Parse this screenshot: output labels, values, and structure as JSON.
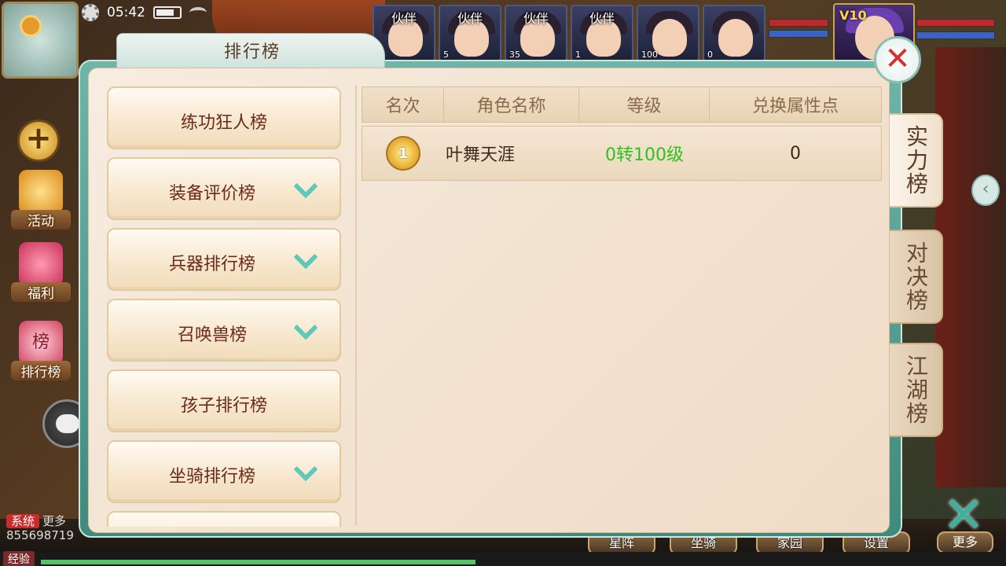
{
  "status_bar": {
    "time": "05:42"
  },
  "partners": [
    {
      "tag": "伙伴",
      "level": ""
    },
    {
      "tag": "伙伴",
      "level": "5"
    },
    {
      "tag": "伙伴",
      "level": "35"
    },
    {
      "tag": "伙伴",
      "level": "1"
    },
    {
      "tag": "",
      "level": "100"
    },
    {
      "tag": "",
      "level": "0"
    }
  ],
  "player": {
    "vip": "V10"
  },
  "panel": {
    "title": "排行榜",
    "close": "✕"
  },
  "categories": [
    {
      "label": "练功狂人榜",
      "expandable": false
    },
    {
      "label": "装备评价榜",
      "expandable": true
    },
    {
      "label": "兵器排行榜",
      "expandable": true
    },
    {
      "label": "召唤兽榜",
      "expandable": true
    },
    {
      "label": "孩子排行榜",
      "expandable": false
    },
    {
      "label": "坐骑排行榜",
      "expandable": true
    }
  ],
  "table": {
    "headers": [
      "名次",
      "角色名称",
      "等级",
      "兑换属性点"
    ],
    "rows": [
      {
        "rank": "1",
        "name": "叶舞天涯",
        "level": "0转100级",
        "points": "0"
      }
    ]
  },
  "right_tabs": [
    {
      "label": "实力榜",
      "active": true
    },
    {
      "label": "对决榜",
      "active": false
    },
    {
      "label": "江湖榜",
      "active": false
    }
  ],
  "left_buttons": {
    "activity": "活动",
    "welfare": "福利",
    "ranking": "排行榜",
    "ranking_icon_text": "榜"
  },
  "chat": {
    "system_tag": "系统",
    "line1": "更多",
    "line2": "855698719"
  },
  "bottom_buttons": {
    "b1": "星阵",
    "b2": "坐骑",
    "b3": "家园",
    "b4": "设置",
    "more": "更多"
  },
  "exp_label": "经验",
  "exp_progress": 0.45,
  "colors": {
    "panel_bg": "#f6ece0",
    "teal_frame": "#6fb5a8",
    "chevron": "#5fc8b9",
    "level_green": "#2fc21e",
    "close_red": "#d6322a"
  },
  "icons": [
    "gear-icon",
    "battery-icon",
    "wifi-icon",
    "compass-icon",
    "plus-icon",
    "chat-icon",
    "close-icon",
    "chevron-down-icon",
    "gold-medal-icon",
    "left-arrow-icon"
  ]
}
